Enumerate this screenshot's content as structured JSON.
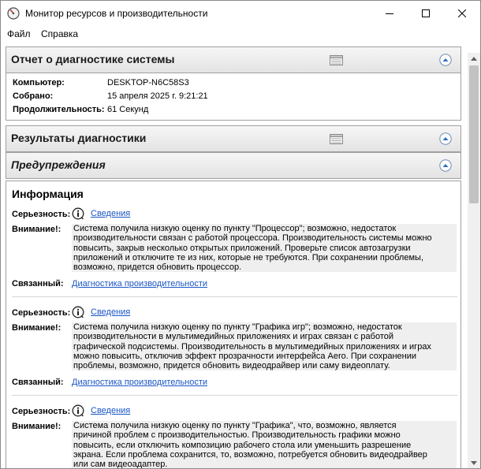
{
  "window": {
    "title": "Монитор ресурсов и производительности"
  },
  "menu": {
    "file": "Файл",
    "help": "Справка"
  },
  "report": {
    "title": "Отчет о диагностике системы",
    "computer_label": "Компьютер:",
    "computer_value": "DESKTOP-N6C58S3",
    "collected_label": "Собрано:",
    "collected_value": "15 апреля 2025 г. 9:21:21",
    "duration_label": "Продолжительность:",
    "duration_value": "61 Секунд"
  },
  "results": {
    "title": "Результаты диагностики"
  },
  "warnings": {
    "title": "Предупреждения"
  },
  "info": {
    "title": "Информация",
    "entries": [
      {
        "severity_label": "Серьезность:",
        "details": "Сведения",
        "warning_label": "Внимание!:",
        "lines": [
          "Система получила низкую оценку по пункту \"Процессор\"; возможно, недостаток",
          "производительности связан с работой процессора. Производительность системы можно",
          "повысить, закрыв несколько открытых приложений. Проверьте список автозагрузки",
          "приложений и отключите те из них, которые не требуются. При сохранении проблемы,",
          "возможно, придется обновить процессор."
        ],
        "related_label": "Связанный:",
        "related_link": "Диагностика производительности"
      },
      {
        "severity_label": "Серьезность:",
        "details": "Сведения",
        "warning_label": "Внимание!:",
        "lines": [
          "Система получила низкую оценку по пункту \"Графика игр\"; возможно, недостаток",
          "производительности в мультимедийных приложениях и играх связан с работой",
          "графической подсистемы. Производительность в мультимедийных приложениях и играх",
          "можно повысить, отключив эффект прозрачности интерфейса Aero. При сохранении",
          "проблемы, возможно, придется обновить видеодрайвер или саму видеоплату."
        ],
        "related_label": "Связанный:",
        "related_link": "Диагностика производительности"
      },
      {
        "severity_label": "Серьезность:",
        "details": "Сведения",
        "warning_label": "Внимание!:",
        "lines": [
          "Система получила низкую оценку по пункту \"Графика\", что, возможно, является",
          "причиной проблем с производительностью. Производительность графики можно",
          "повысить, если отключить композицию рабочего стола или уменьшить разрешение",
          "экрана. Если проблема сохранится, то, возможно, потребуется обновить видеодрайвер",
          "или сам видеоадаптер."
        ]
      }
    ]
  },
  "icons": {
    "app": "resource-monitor-icon",
    "info": "info-icon",
    "collapse": "collapse-up-icon",
    "report": "report-view-icon"
  },
  "colors": {
    "link": "#1a56c4",
    "header_bg": "#e8e8e8",
    "collapse_btn": "#2e6dbd"
  }
}
